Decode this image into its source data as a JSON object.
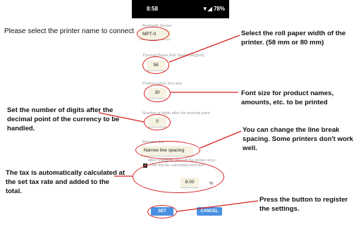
{
  "status_bar": {
    "time": "8:58",
    "indicators": "▼◢ 78%"
  },
  "form": {
    "bluetooth": {
      "label": "Bluetooth Device",
      "value": "MPT-II"
    },
    "paper_size": {
      "label": "Thermal Paper Roll Size[width][mm]",
      "value": "58"
    },
    "font_size": {
      "label": "Product name font size",
      "value": "30"
    },
    "decimal_digits": {
      "label": "Number of digits after the decimal point",
      "value": "0"
    },
    "line_spacing": {
      "label": "Between line",
      "value": "Narrow line spacing"
    },
    "line_spacing_note": "After changing, turn off the printer once.",
    "tax_checkbox": {
      "label": "Use the tax calculation function",
      "checked": true
    },
    "tax_rate": {
      "value": "8.00",
      "unit": "%"
    },
    "set_label": "SET",
    "cancel_label": "CANCEL"
  },
  "annotations": {
    "printer_name": "Please select the printer name to connect",
    "paper_width": "Select the roll paper width of the printer. (58 mm or 80 mm)",
    "font_size": "Font size for product names, amounts, etc. to be printed",
    "decimal_digits": "Set the number of digits after the decimal point of the currency to be handled.",
    "line_spacing": "You can change the line break spacing. Some printers don't work well.",
    "tax": "The tax is automatically calculated at the set tax rate and added to the total.",
    "register": "Press the button to register the settings."
  },
  "colors": {
    "annotation": "#d62020",
    "button": "#4a90e2",
    "field_bg": "#f6f2e1"
  }
}
